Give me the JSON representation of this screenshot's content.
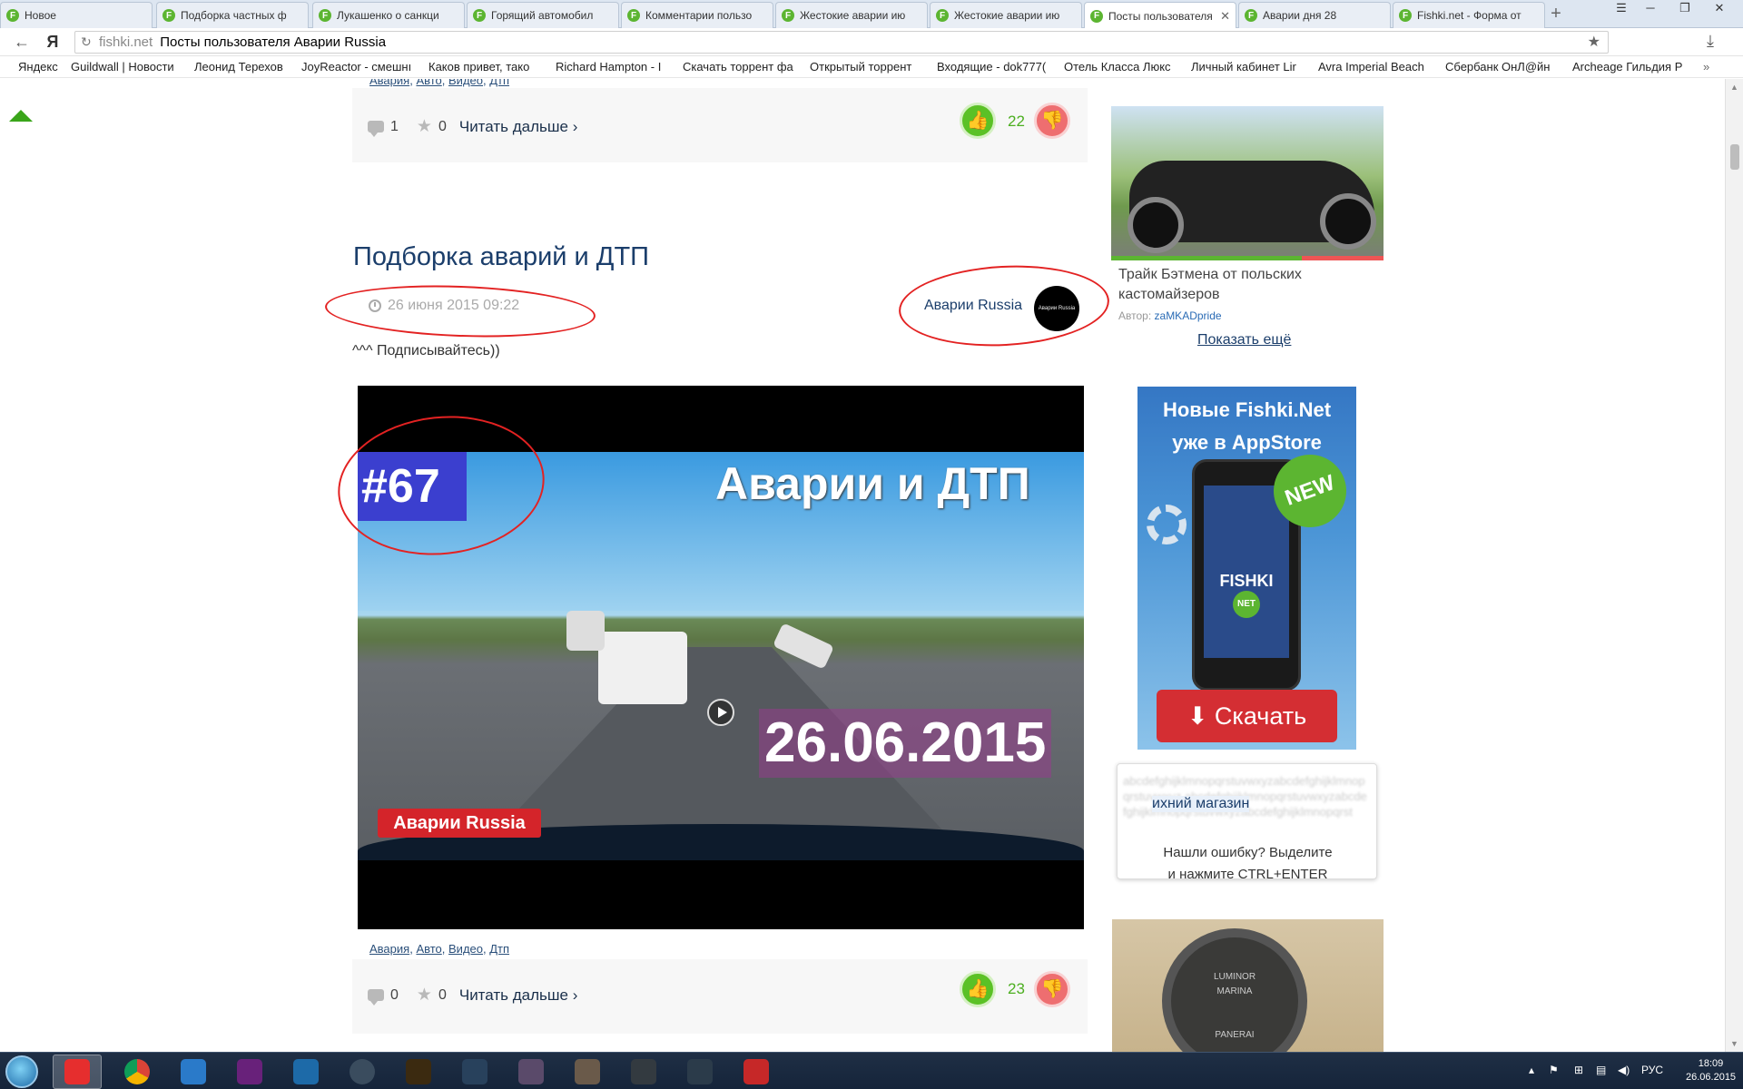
{
  "browser": {
    "tabs": [
      {
        "label": "Новое",
        "active": false
      },
      {
        "label": "Подборка частных ф",
        "active": false
      },
      {
        "label": "Лукашенко о санкци",
        "active": false
      },
      {
        "label": "Горящий автомобил",
        "active": false
      },
      {
        "label": "Комментарии пользо",
        "active": false
      },
      {
        "label": "Жестокие аварии ию",
        "active": false
      },
      {
        "label": "Жестокие аварии ию",
        "active": false
      },
      {
        "label": "Посты пользователя",
        "active": true
      },
      {
        "label": "Аварии дня 28",
        "active": false
      },
      {
        "label": "Fishki.net - Форма от",
        "active": false
      }
    ],
    "address": {
      "domain": "fishki.net",
      "page_title": "Посты пользователя Аварии Russia"
    },
    "bookmarks": [
      "Яндекс",
      "Guildwall | Новости",
      "Леонид Терехов",
      "JoyReactor - смешнı",
      "Каков привет, тако",
      "Richard Hampton - I",
      "Скачать торрент фа",
      "Открытый торрент",
      "Входящие - dok777(",
      "Отель Класса Люкс",
      "Личный кабинет Lir",
      "Avra Imperial Beach",
      "Сбербанк ОнЛ@йн",
      "Archeage Гильдия Р"
    ],
    "accent_color": "#5cb531"
  },
  "prev_post": {
    "tags": [
      "Авария",
      "Авто",
      "Видео",
      "Дтп"
    ],
    "comments": "1",
    "favorites": "0",
    "read_more": "Читать дальше ›",
    "likes": "22"
  },
  "post": {
    "title": "Подборка аварий и ДТП",
    "date": "26 июня 2015 09:22",
    "author": "Аварии Russia",
    "avatar_text": "Аварии Russia",
    "intro": "^^^ Подписывайтесь))",
    "video": {
      "number": "#67",
      "title": "Аварии и ДТП",
      "date": "26.06.2015",
      "brand": "Аварии Russia"
    },
    "tags": [
      "Авария",
      "Авто",
      "Видео",
      "Дтп"
    ],
    "comments": "0",
    "favorites": "0",
    "read_more": "Читать дальше ›",
    "likes": "23"
  },
  "sidebar": {
    "feature": {
      "caption": "Трайк Бэтмена от польских кастомайзеров",
      "author_label": "Автор:",
      "author": "zaMKADpride"
    },
    "show_more": "Показать ещё",
    "app_banner": {
      "title_line1": "Новые Fishki.Net",
      "title_line2": "уже в AppStore",
      "badge": "NEW",
      "phone_brand": "FISHKI",
      "phone_net": "NET",
      "button": "⬇ Скачать"
    },
    "error_box": {
      "highlight": "ихний магазин",
      "line1": "Нашли ошибку? Выделите",
      "line2": "и нажмите CTRL+ENTER"
    },
    "watch_ad": {
      "line1": "LUMINOR",
      "line2": "MARINA",
      "brand": "PANERAI"
    }
  },
  "taskbar": {
    "language": "РУС",
    "time": "18:09",
    "date": "26.06.2015"
  }
}
